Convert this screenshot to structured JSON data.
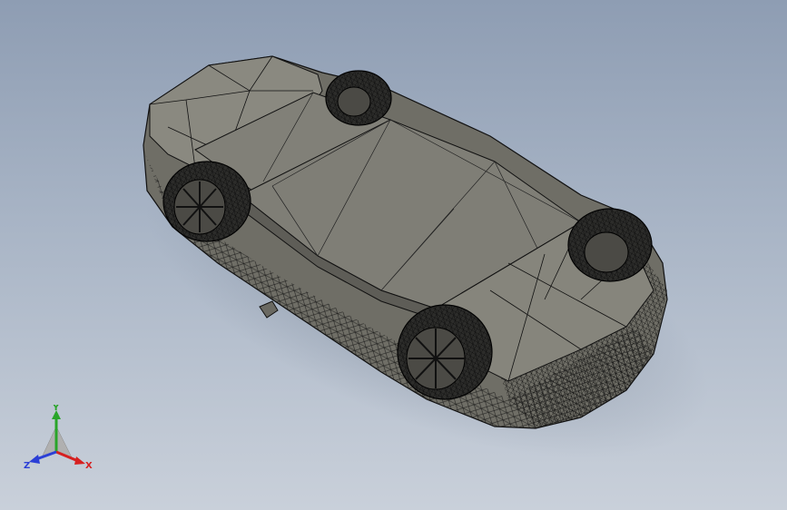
{
  "viewport": {
    "background_top": "#8e9db3",
    "background_bottom": "#c9d0da",
    "model": {
      "description_icon": "car-body-mesh-icon",
      "surface_color": "#7c7b72",
      "edge_color": "#121212"
    }
  },
  "triad": {
    "x_label": "X",
    "y_label": "Y",
    "z_label": "Z",
    "x_color": "#d62020",
    "y_color": "#2aa52a",
    "z_color": "#2b3fd6"
  }
}
